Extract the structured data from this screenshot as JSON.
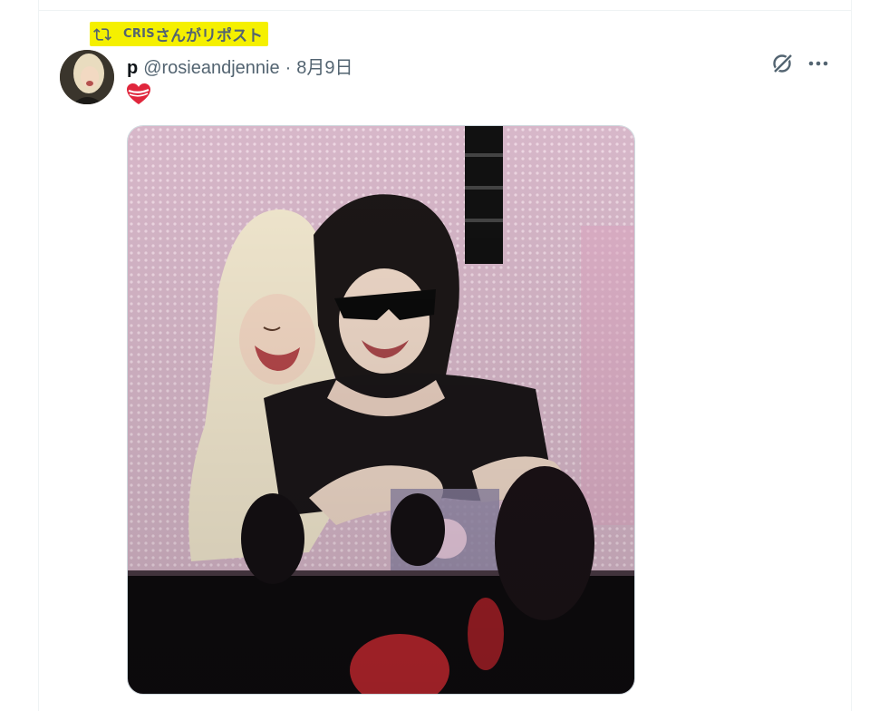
{
  "repost": {
    "reposter": "CRIS",
    "suffix": "さんがリポスト",
    "icon": "repost-icon",
    "highlight_color": "#f5f000"
  },
  "post": {
    "display_name": "p",
    "handle": "@rosieandjennie",
    "separator": "·",
    "date": "8月9日",
    "emoji": "heart-with-ribbon-icon",
    "actions": [
      "grok-icon",
      "more-icon"
    ],
    "media": {
      "alt_type": "photo",
      "icon": "photo-image"
    }
  },
  "colors": {
    "primary_text": "#0f1419",
    "secondary_text": "#536471",
    "border": "#eff3f4"
  }
}
